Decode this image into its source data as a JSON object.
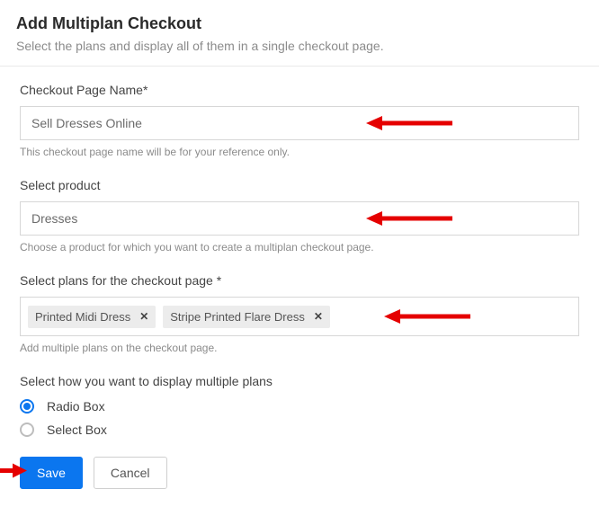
{
  "header": {
    "title": "Add Multiplan Checkout",
    "subtitle": "Select the plans and display all of them in a single checkout page."
  },
  "fields": {
    "name": {
      "label": "Checkout Page Name*",
      "value": "Sell Dresses Online",
      "helper": "This checkout page name will be for your reference only."
    },
    "product": {
      "label": "Select product",
      "value": "Dresses",
      "helper": "Choose a product for which you want to create a multiplan checkout page."
    },
    "plans": {
      "label": "Select plans for the checkout page *",
      "tags": [
        "Printed Midi Dress",
        "Stripe Printed Flare Dress"
      ],
      "helper": "Add multiple plans on the checkout page."
    },
    "display": {
      "label": "Select how you want to display multiple plans",
      "options": [
        "Radio Box",
        "Select Box"
      ],
      "selected": "Radio Box"
    }
  },
  "actions": {
    "save": "Save",
    "cancel": "Cancel"
  },
  "icons": {
    "x": "✕"
  }
}
